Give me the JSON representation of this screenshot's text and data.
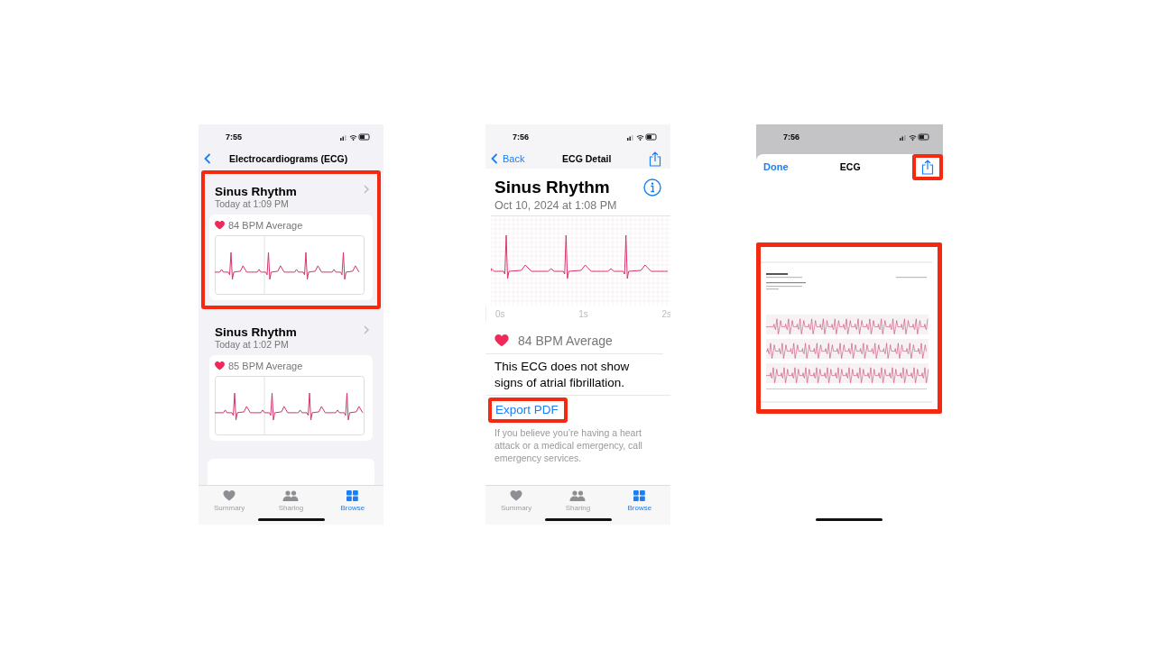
{
  "screens": [
    {
      "kind": "list",
      "time": "7:55",
      "title": "Electrocardiograms (ECG)",
      "records": [
        {
          "title": "Sinus Rhythm",
          "time": "Today at 1:09 PM",
          "bpm": "84 BPM Average",
          "highlighted": true
        },
        {
          "title": "Sinus Rhythm",
          "time": "Today at 1:02 PM",
          "bpm": "85 BPM Average",
          "highlighted": false
        }
      ],
      "tabs": [
        {
          "label": "Summary",
          "selected": false
        },
        {
          "label": "Sharing",
          "selected": false
        },
        {
          "label": "Browse",
          "selected": true
        }
      ]
    },
    {
      "kind": "detail",
      "time": "7:56",
      "back": "Back",
      "title": "ECG Detail",
      "heading": "Sinus Rhythm",
      "date": "Oct 10, 2024 at 1:08 PM",
      "axis_labels": [
        "0s",
        "1s",
        "2s"
      ],
      "bpm": "84 BPM Average",
      "result": "This ECG does not show signs of atrial fibrillation.",
      "export": {
        "label": "Export PDF",
        "highlighted": true
      },
      "note": "If you believe you’re having a heart attack or a medical emergency, call emergency services.",
      "tabs": [
        {
          "label": "Summary",
          "selected": false
        },
        {
          "label": "Sharing",
          "selected": false
        },
        {
          "label": "Browse",
          "selected": true
        }
      ]
    },
    {
      "kind": "pdf",
      "time": "7:56",
      "done": "Done",
      "title": "ECG",
      "share_highlighted": true,
      "preview_highlighted": true
    }
  ]
}
